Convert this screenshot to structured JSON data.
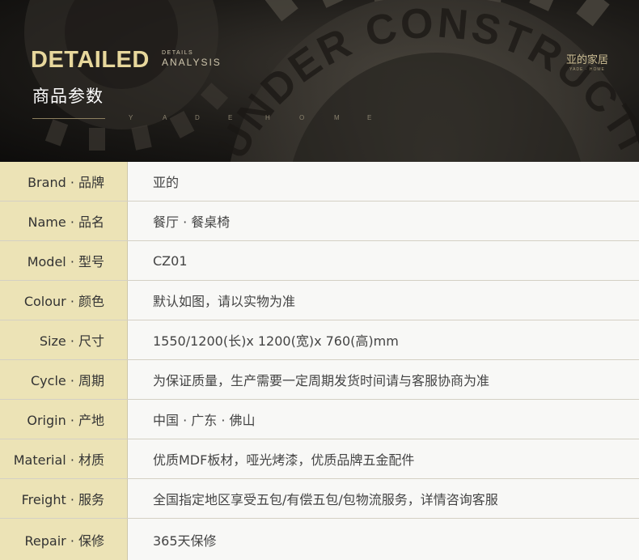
{
  "banner": {
    "title_en": "DETAILED",
    "subtitle_top": "DETAILS",
    "subtitle_bottom": "ANALYSIS",
    "title_cn": "商品参数",
    "spaced_letters": [
      "Y",
      "A",
      "D",
      "E",
      "H",
      "O",
      "M",
      "E"
    ],
    "gear_text": "UNDER CONSTRUCTION",
    "logo_cn": "亚的家居",
    "logo_en": "YADE · HOME"
  },
  "specs": [
    {
      "label": "Brand · 品牌",
      "value": "亚的"
    },
    {
      "label": "Name · 品名",
      "value": "餐厅 · 餐桌椅"
    },
    {
      "label": "Model · 型号",
      "value": "CZ01"
    },
    {
      "label": "Colour · 颜色",
      "value": "默认如图，请以实物为准"
    },
    {
      "label": "Size · 尺寸",
      "value": "1550/1200(长)x 1200(宽)x 760(高)mm"
    },
    {
      "label": "Cycle · 周期",
      "value": "为保证质量，生产需要一定周期发货时间请与客服协商为准"
    },
    {
      "label": "Origin · 产地",
      "value": "中国 · 广东 · 佛山"
    },
    {
      "label": "Material · 材质",
      "value": "优质MDF板材，哑光烤漆，优质品牌五金配件"
    },
    {
      "label": "Freight · 服务",
      "value": "全国指定地区享受五包/有偿五包/包物流服务，详情咨询客服"
    },
    {
      "label": "Repair · 保修",
      "value": "365天保修"
    }
  ],
  "colors": {
    "label_bg": "#ece3b6",
    "value_bg": "#f8f8f6",
    "title_gold": "#e7d79c"
  }
}
